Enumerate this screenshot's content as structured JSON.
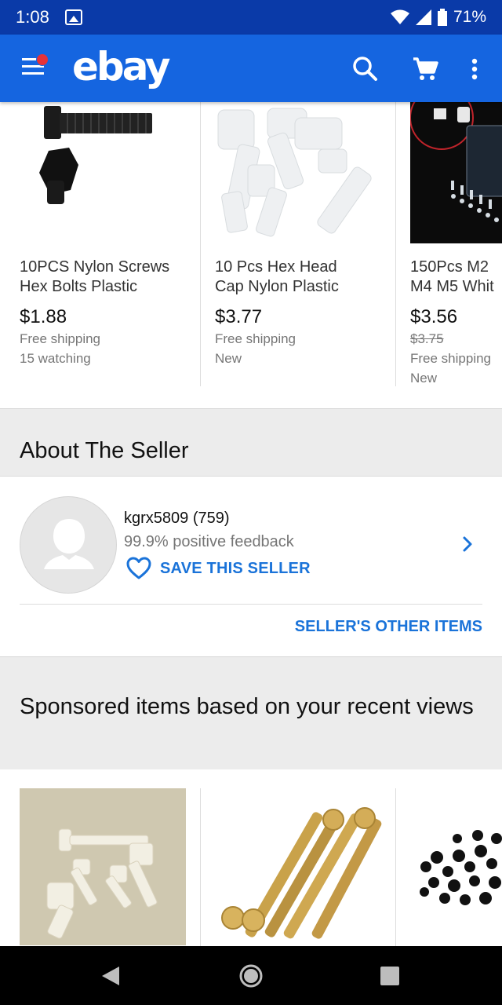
{
  "status_bar": {
    "time": "1:08",
    "battery": "71%"
  },
  "app_bar": {
    "logo": "ebay"
  },
  "top_items": [
    {
      "title_line1": "10PCS Nylon Screws",
      "title_line2": "Hex Bolts Plastic",
      "price": "$1.88",
      "meta1": "Free shipping",
      "meta2": "15 watching"
    },
    {
      "title_line1": "10 Pcs Hex Head",
      "title_line2": "Cap Nylon Plastic",
      "price": "$3.77",
      "meta1": "Free shipping",
      "meta2": "New"
    },
    {
      "title_line1": "150Pcs M2",
      "title_line2": "M4 M5 Whit",
      "price": "$3.56",
      "original_price": "$3.75",
      "meta1": "Free shipping",
      "meta2": "New"
    }
  ],
  "about_seller": {
    "heading": "About The Seller",
    "seller": "kgrx5809 (759)",
    "feedback": "99.9% positive feedback",
    "save_label": "SAVE THIS SELLER",
    "other_items_label": "SELLER'S OTHER ITEMS"
  },
  "sponsored": {
    "heading": "Sponsored items based on your recent views"
  },
  "colors": {
    "status_bar": "#0a3aa8",
    "app_bar": "#1565e0",
    "link": "#1a73d9",
    "notification_dot": "#e53238"
  }
}
